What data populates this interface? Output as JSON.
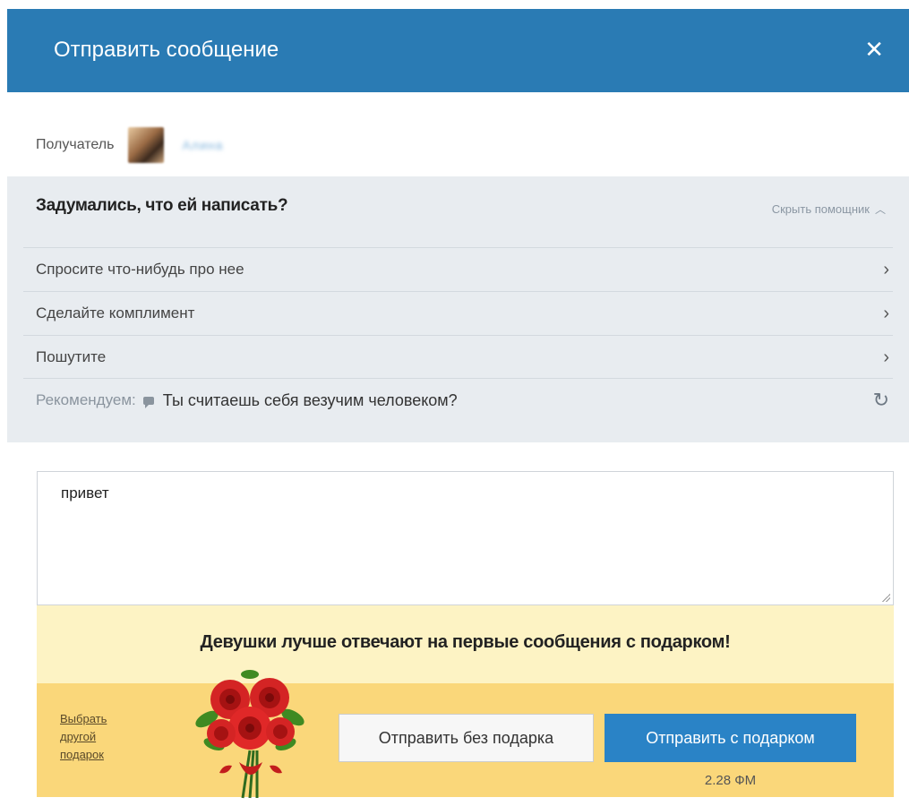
{
  "dialog": {
    "title": "Отправить сообщение",
    "close_icon": "close-icon",
    "accent_color": "#2a7bb4"
  },
  "recipient": {
    "label": "Получатель",
    "name": "Алина"
  },
  "helper": {
    "question": "Задумались, что ей написать?",
    "hide_label": "Скрыть помощник",
    "options": [
      {
        "label": "Спросите что-нибудь про нее"
      },
      {
        "label": "Сделайте комплимент"
      },
      {
        "label": "Пошутите"
      }
    ],
    "recommend_label": "Рекомендуем:",
    "recommend_text": "Ты считаешь себя везучим человеком?"
  },
  "message": {
    "value": "привет"
  },
  "promo": {
    "text": "Девушки лучше отвечают на первые сообщения с подарком!"
  },
  "gift": {
    "choose_other": "Выбрать другой подарок",
    "send_without": "Отправить без подарка",
    "send_with": "Отправить с подарком",
    "price": "2.28 ФМ"
  }
}
